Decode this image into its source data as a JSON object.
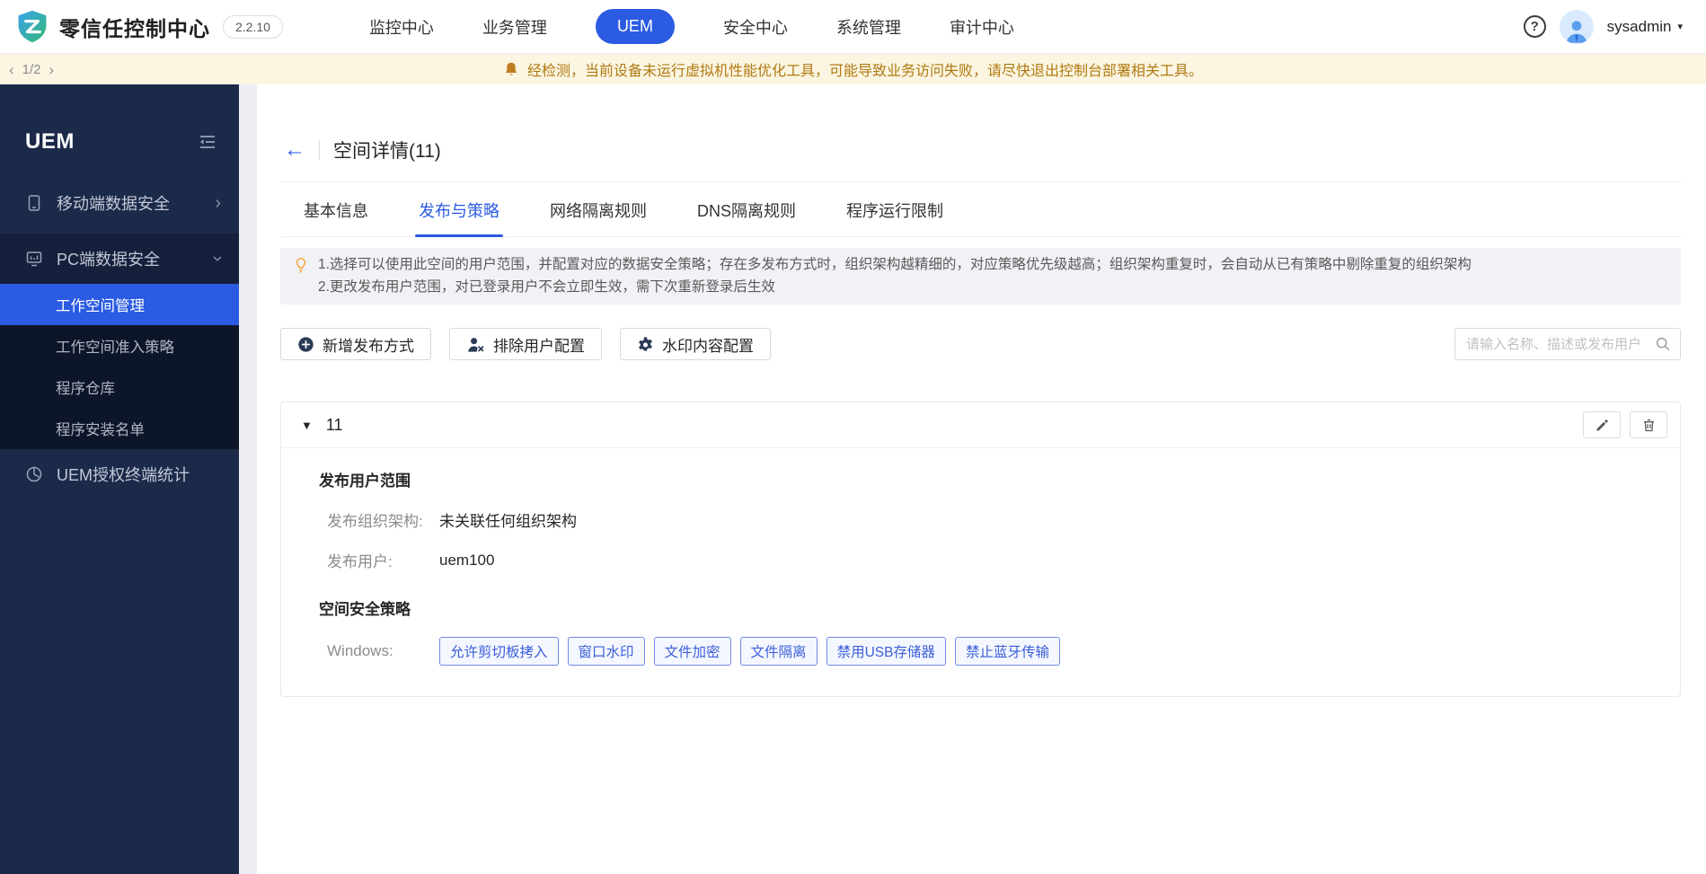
{
  "colors": {
    "accent_blue": "#2b5be2",
    "sidebar_bg": "#1c2a4a",
    "sidebar_submenu_bg": "#0d1628",
    "banner_bg": "#fbf5e1",
    "banner_text": "#b07a12",
    "tag_text": "#3c5fd8",
    "tag_border": "#6e8ae6",
    "tag_bg": "#f4f7ff"
  },
  "header": {
    "brand": "零信任控制中心",
    "version": "2.2.10",
    "nav": [
      {
        "label": "监控中心"
      },
      {
        "label": "业务管理"
      },
      {
        "label": "UEM",
        "active": true
      },
      {
        "label": "安全中心"
      },
      {
        "label": "系统管理"
      },
      {
        "label": "审计中心"
      }
    ],
    "help_glyph": "?",
    "username": "sysadmin"
  },
  "banner": {
    "pager": {
      "prev": "‹",
      "current": "1/2",
      "next": "›"
    },
    "message": "经检测，当前设备未运行虚拟机性能优化工具，可能导致业务访问失败，请尽快退出控制台部署相关工具。"
  },
  "sidebar": {
    "title": "UEM",
    "items": [
      {
        "label": "移动端数据安全",
        "icon": "mobile-device-icon",
        "state": "collapsed"
      },
      {
        "label": "PC端数据安全",
        "icon": "pc-monitor-icon",
        "state": "expanded",
        "children": [
          {
            "label": "工作空间管理",
            "active": true
          },
          {
            "label": "工作空间准入策略"
          },
          {
            "label": "程序仓库"
          },
          {
            "label": "程序安装名单"
          }
        ]
      },
      {
        "label": "UEM授权终端统计",
        "icon": "terminal-stats-icon"
      }
    ]
  },
  "main": {
    "page_title": "空间详情(11)",
    "tabs": [
      {
        "label": "基本信息"
      },
      {
        "label": "发布与策略",
        "active": true
      },
      {
        "label": "网络隔离规则"
      },
      {
        "label": "DNS隔离规则"
      },
      {
        "label": "程序运行限制"
      }
    ],
    "notice": {
      "line1": "1.选择可以使用此空间的用户范围，并配置对应的数据安全策略；存在多发布方式时，组织架构越精细的，对应策略优先级越高；组织架构重复时，会自动从已有策略中剔除重复的组织架构",
      "line2": "2.更改发布用户范围，对已登录用户不会立即生效，需下次重新登录后生效"
    },
    "toolbar": {
      "add_button": "新增发布方式",
      "exclude_button": "排除用户配置",
      "watermark_button": "水印内容配置",
      "search_placeholder": "请输入名称、描述或发布用户"
    },
    "space_card": {
      "name": "11",
      "scope_title": "发布用户范围",
      "org_label": "发布组织架构:",
      "org_value": "未关联任何组织架构",
      "user_label": "发布用户:",
      "user_value": "uem100",
      "policy_title": "空间安全策略",
      "platform_label": "Windows:",
      "tags": [
        "允许剪切板拷入",
        "窗口水印",
        "文件加密",
        "文件隔离",
        "禁用USB存储器",
        "禁止蓝牙传输"
      ]
    }
  }
}
